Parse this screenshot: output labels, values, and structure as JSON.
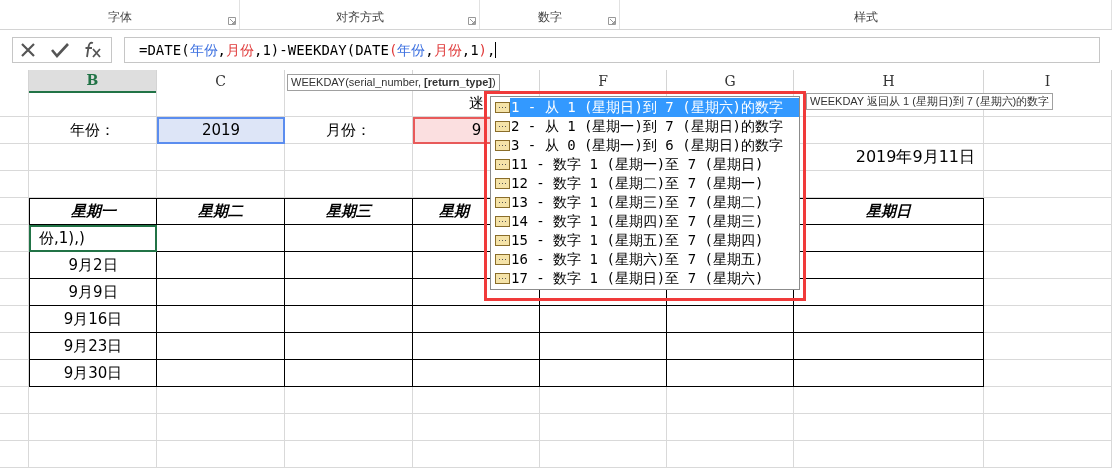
{
  "ribbon_groups": [
    {
      "label": "字体",
      "launcher": true
    },
    {
      "label": "对齐方式",
      "launcher": true
    },
    {
      "label": "数字",
      "launcher": true
    },
    {
      "label": "样式",
      "launcher": false
    }
  ],
  "formula_bar": {
    "segments": [
      {
        "text": "=DATE("
      },
      {
        "text": "年份",
        "color": "#3b6fe0"
      },
      {
        "text": ","
      },
      {
        "text": "月份",
        "color": "#e03b3b"
      },
      {
        "text": ",1)-WEEKDAY(DATE"
      },
      {
        "text": "(",
        "color": "#e03b3b"
      },
      {
        "text": "年份",
        "color": "#3b6fe0"
      },
      {
        "text": ","
      },
      {
        "text": "月份",
        "color": "#e03b3b"
      },
      {
        "text": ",1"
      },
      {
        "text": ")",
        "color": "#e03b3b"
      },
      {
        "text": ","
      }
    ]
  },
  "column_headers": [
    {
      "selected": false
    },
    {
      "label": "B",
      "selected": true
    },
    {
      "label": "C",
      "selected": false
    },
    {
      "selected": false
    },
    {
      "selected": false
    },
    {
      "label": "F",
      "selected": false
    },
    {
      "label": "G",
      "selected": false
    },
    {
      "label": "H",
      "selected": false
    },
    {
      "label": "I",
      "selected": false
    }
  ],
  "rows": [
    {
      "bordered": false,
      "cells": [
        {},
        {},
        {},
        {},
        {
          "text": "迷",
          "kind": "plain"
        },
        {},
        {},
        {},
        {}
      ]
    },
    {
      "bordered": false,
      "cells": [
        {},
        {
          "text": "年份：",
          "kind": "plain"
        },
        {
          "text": "2019",
          "kind": "year"
        },
        {
          "text": "月份：",
          "kind": "plain"
        },
        {
          "text": "9",
          "kind": "month"
        },
        {},
        {},
        {},
        {}
      ]
    },
    {
      "bordered": false,
      "cells": [
        {},
        {},
        {},
        {},
        {},
        {},
        {},
        {
          "text": "2019年9月11日",
          "kind": "right"
        },
        {}
      ]
    },
    {
      "bordered": false,
      "cells": [
        {},
        {},
        {},
        {},
        {},
        {},
        {},
        {},
        {}
      ]
    },
    {
      "bordered": true,
      "cells": [
        {},
        {
          "text": "星期一",
          "kind": "header"
        },
        {
          "text": "星期二",
          "kind": "header"
        },
        {
          "text": "星期三",
          "kind": "header"
        },
        {
          "text": "星期",
          "kind": "header_left"
        },
        {},
        {},
        {
          "text": "星期日",
          "kind": "header"
        },
        {}
      ]
    },
    {
      "bordered": true,
      "cells": [
        {},
        {
          "text": "份,1),)",
          "kind": "editing"
        },
        {},
        {},
        {},
        {},
        {},
        {},
        {}
      ]
    },
    {
      "bordered": true,
      "cells": [
        {},
        {
          "text": "9月2日",
          "kind": "plain"
        },
        {},
        {},
        {},
        {},
        {},
        {},
        {}
      ]
    },
    {
      "bordered": true,
      "cells": [
        {},
        {
          "text": "9月9日",
          "kind": "plain"
        },
        {},
        {},
        {},
        {},
        {},
        {},
        {}
      ]
    },
    {
      "bordered": true,
      "cells": [
        {},
        {
          "text": "9月16日",
          "kind": "plain"
        },
        {},
        {},
        {},
        {},
        {},
        {},
        {}
      ]
    },
    {
      "bordered": true,
      "cells": [
        {},
        {
          "text": "9月23日",
          "kind": "plain"
        },
        {},
        {},
        {},
        {},
        {},
        {},
        {}
      ]
    },
    {
      "bordered": true,
      "cells": [
        {},
        {
          "text": "9月30日",
          "kind": "plain"
        },
        {},
        {},
        {},
        {},
        {},
        {},
        {}
      ]
    },
    {
      "bordered": false,
      "cells": [
        {},
        {},
        {},
        {},
        {},
        {},
        {},
        {},
        {}
      ]
    },
    {
      "bordered": false,
      "cells": [
        {},
        {},
        {},
        {},
        {},
        {},
        {},
        {},
        {}
      ]
    },
    {
      "bordered": false,
      "cells": [
        {},
        {},
        {},
        {},
        {},
        {},
        {},
        {},
        {}
      ]
    }
  ],
  "syntax_tooltip": "WEEKDAY(serial_number, **[return_type]**)",
  "description_tooltip": "WEEKDAY 返回从 1 (星期日)到 7 (星期六)的数字",
  "autocomplete": [
    {
      "label": "1 - 从 1 (星期日)到 7 (星期六)的数字",
      "selected": true
    },
    {
      "label": "2 - 从 1 (星期一)到 7 (星期日)的数字",
      "selected": false
    },
    {
      "label": "3 - 从 0 (星期一)到 6 (星期日)的数字",
      "selected": false
    },
    {
      "label": "11 - 数字 1 (星期一)至 7 (星期日)",
      "selected": false
    },
    {
      "label": "12 - 数字 1 (星期二)至 7 (星期一)",
      "selected": false
    },
    {
      "label": "13 - 数字 1 (星期三)至 7 (星期二)",
      "selected": false
    },
    {
      "label": "14 - 数字 1 (星期四)至 7 (星期三)",
      "selected": false
    },
    {
      "label": "15 - 数字 1 (星期五)至 7 (星期四)",
      "selected": false
    },
    {
      "label": "16 - 数字 1 (星期六)至 7 (星期五)",
      "selected": false
    },
    {
      "label": "17 - 数字 1 (星期日)至 7 (星期六)",
      "selected": false
    }
  ]
}
